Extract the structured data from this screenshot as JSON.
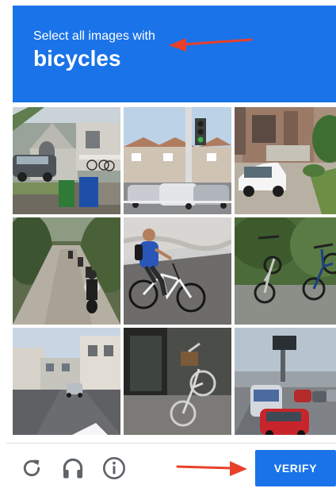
{
  "challenge": {
    "instruction": "Select all images with",
    "target_object": "bicycles"
  },
  "tiles": [
    {
      "row": 1,
      "col": 1,
      "scene": "house-with-bicycles-on-porch"
    },
    {
      "row": 1,
      "col": 2,
      "scene": "traffic-light-and-cars"
    },
    {
      "row": 1,
      "col": 3,
      "scene": "house-with-white-car"
    },
    {
      "row": 2,
      "col": 1,
      "scene": "road-with-motorcycles"
    },
    {
      "row": 2,
      "col": 2,
      "scene": "person-riding-bicycle"
    },
    {
      "row": 2,
      "col": 3,
      "scene": "parked-bicycles"
    },
    {
      "row": 3,
      "col": 1,
      "scene": "street-with-buildings"
    },
    {
      "row": 3,
      "col": 2,
      "scene": "bicycle-against-wall"
    },
    {
      "row": 3,
      "col": 3,
      "scene": "highway-with-bus-and-cars"
    }
  ],
  "footer": {
    "verify_label": "VERIFY",
    "icons": [
      "reload-icon",
      "audio-headphones-icon",
      "info-icon"
    ]
  },
  "colors": {
    "accent_blue": "#1a73e8",
    "annotation_arrow_red": "#e8402b",
    "icon_gray": "#5f6368"
  }
}
